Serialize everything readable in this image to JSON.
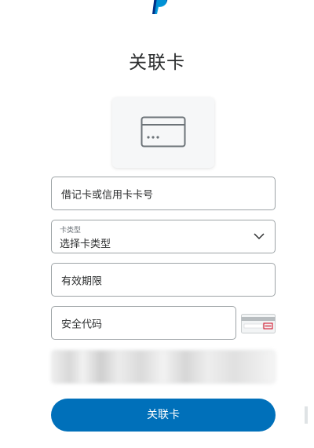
{
  "header": {
    "logo_icon": "paypal-logo-icon",
    "title": "关联卡"
  },
  "card_illustration": {
    "icon": "credit-card-icon"
  },
  "form": {
    "card_number": {
      "placeholder": "借记卡或信用卡卡号"
    },
    "card_type": {
      "label": "卡类型",
      "value": "选择卡类型",
      "icon": "chevron-down-icon"
    },
    "expiry": {
      "placeholder": "有效期限"
    },
    "security_code": {
      "placeholder": "安全代码",
      "help_icon": "cvv-card-icon"
    },
    "obscured_field": {
      "icon": "blurred-field"
    }
  },
  "actions": {
    "submit_label": "关联卡"
  },
  "colors": {
    "primary": "#0070ba",
    "border": "#9da3a6",
    "text": "#2c2e2f",
    "muted": "#6c7378"
  }
}
